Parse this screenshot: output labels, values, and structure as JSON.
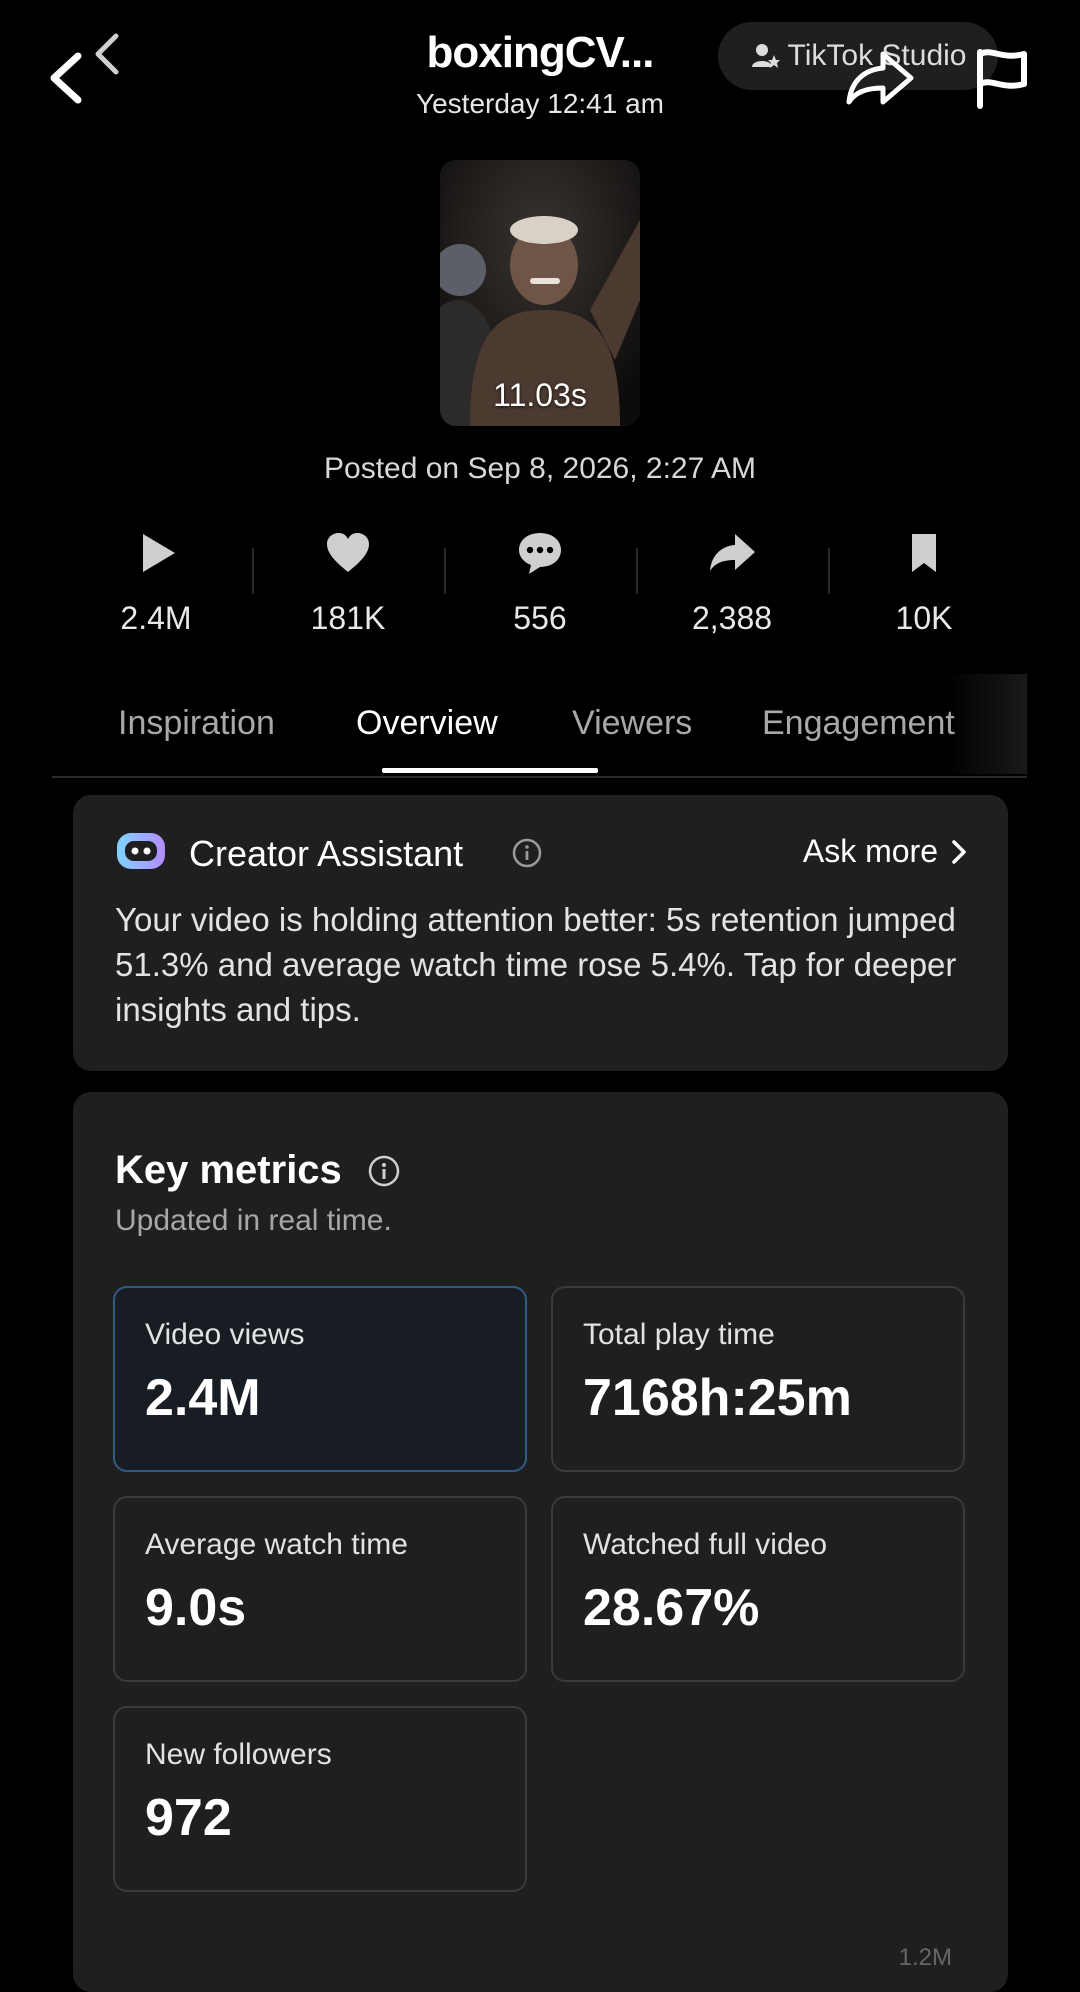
{
  "header": {
    "title": "boxingCV...",
    "subtitle": "Yesterday 12:41 am",
    "studio_label": "TikTok Studio"
  },
  "video": {
    "duration": "11.03s",
    "posted": "Posted on Sep 8, 2026, 2:27 AM"
  },
  "stats": [
    {
      "icon": "play-icon",
      "value": "2.4M"
    },
    {
      "icon": "heart-icon",
      "value": "181K"
    },
    {
      "icon": "comment-icon",
      "value": "556"
    },
    {
      "icon": "share-icon",
      "value": "2,388"
    },
    {
      "icon": "bookmark-icon",
      "value": "10K"
    }
  ],
  "tabs": [
    {
      "label": "Inspiration",
      "active": false
    },
    {
      "label": "Overview",
      "active": true
    },
    {
      "label": "Viewers",
      "active": false
    },
    {
      "label": "Engagement",
      "active": false
    }
  ],
  "assistant": {
    "title": "Creator Assistant",
    "ask_more": "Ask more",
    "body": "Your video is holding attention better: 5s retention jumped 51.3% and average watch time rose 5.4%. Tap for deeper insights and tips."
  },
  "key_metrics": {
    "title": "Key metrics",
    "subtitle": "Updated in real time.",
    "tiles": [
      {
        "label": "Video views",
        "value": "2.4M",
        "selected": true
      },
      {
        "label": "Total play time",
        "value": "7168h:25m",
        "selected": false
      },
      {
        "label": "Average watch time",
        "value": "9.0s",
        "selected": false
      },
      {
        "label": "Watched full video",
        "value": "28.67%",
        "selected": false
      },
      {
        "label": "New followers",
        "value": "972",
        "selected": false
      }
    ],
    "partial_axis_label": "1.2M"
  },
  "colors": {
    "background": "#000000",
    "card": "#1f1f20",
    "selected_border": "#2f5b86"
  }
}
